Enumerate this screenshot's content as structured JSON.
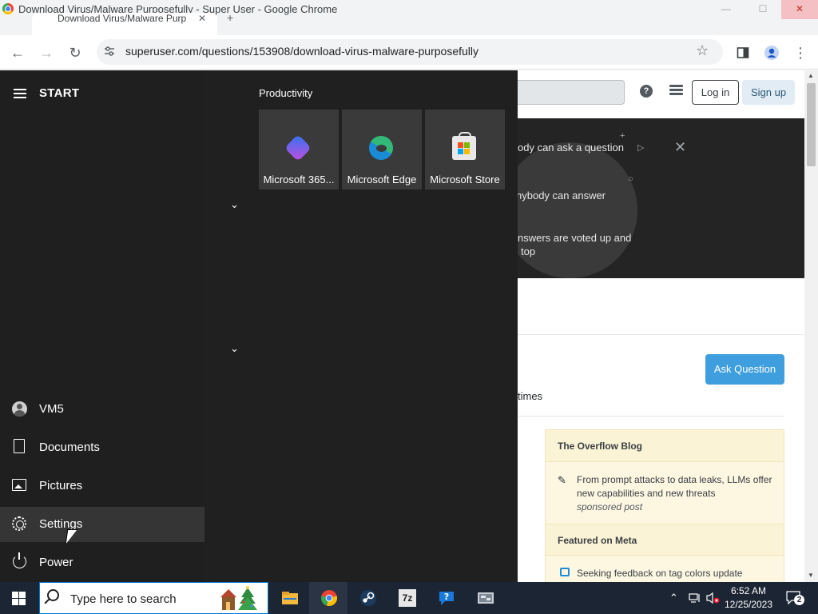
{
  "window": {
    "title": "Download Virus/Malware Purposefully - Super User - Google Chrome",
    "controls": {
      "minimize": "—",
      "maximize": "☐",
      "close": "✕"
    }
  },
  "tab": {
    "label": "Download Virus/Malware Purp",
    "close": "✕",
    "new_tab": "+"
  },
  "toolbar": {
    "back": "←",
    "forward": "→",
    "reload": "↻",
    "site_info_icon": "tune-icon",
    "url": "superuser.com/questions/153908/download-virus-malware-purposefully",
    "bookmark": "☆",
    "side_panel_icon": "side-panel-icon",
    "profile_icon": "profile-icon",
    "menu": "⋮"
  },
  "superuser": {
    "help": "?",
    "login": "Log in",
    "signup": "Sign up",
    "hero_lines": [
      "ody can ask a question",
      "nybody can answer",
      "nswers are voted up and",
      "top"
    ],
    "hero_close": "✕",
    "ask_question": "Ask Question",
    "times_text": "times",
    "blog_heading": "The Overflow Blog",
    "blog_item": "From prompt attacks to data leaks, LLMs offer new capabilities and new threats",
    "blog_item_sponsored": "sponsored post",
    "meta_heading": "Featured on Meta",
    "meta_item": "Seeking feedback on tag colors update"
  },
  "start_menu": {
    "title": "START",
    "user": "VM5",
    "items": [
      {
        "label": "Documents",
        "icon": "document-icon"
      },
      {
        "label": "Pictures",
        "icon": "pictures-icon"
      },
      {
        "label": "Settings",
        "icon": "gear-icon"
      },
      {
        "label": "Power",
        "icon": "power-icon"
      }
    ],
    "group_label": "Productivity",
    "tiles": [
      {
        "label": "Microsoft 365...",
        "icon": "microsoft-365-icon"
      },
      {
        "label": "Microsoft Edge",
        "icon": "edge-icon"
      },
      {
        "label": "Microsoft Store",
        "icon": "store-icon"
      }
    ],
    "chevron": "⌄"
  },
  "taskbar": {
    "search_placeholder": "Type here to search",
    "apps": [
      "file-explorer-icon",
      "chrome-icon",
      "steam-icon",
      "7zip-icon",
      "help-icon",
      "vm-icon"
    ],
    "sevenzip_label": "7z",
    "tray_up": "⌃",
    "notification_count": "2",
    "time": "6:52 AM",
    "date": "12/25/2023"
  }
}
